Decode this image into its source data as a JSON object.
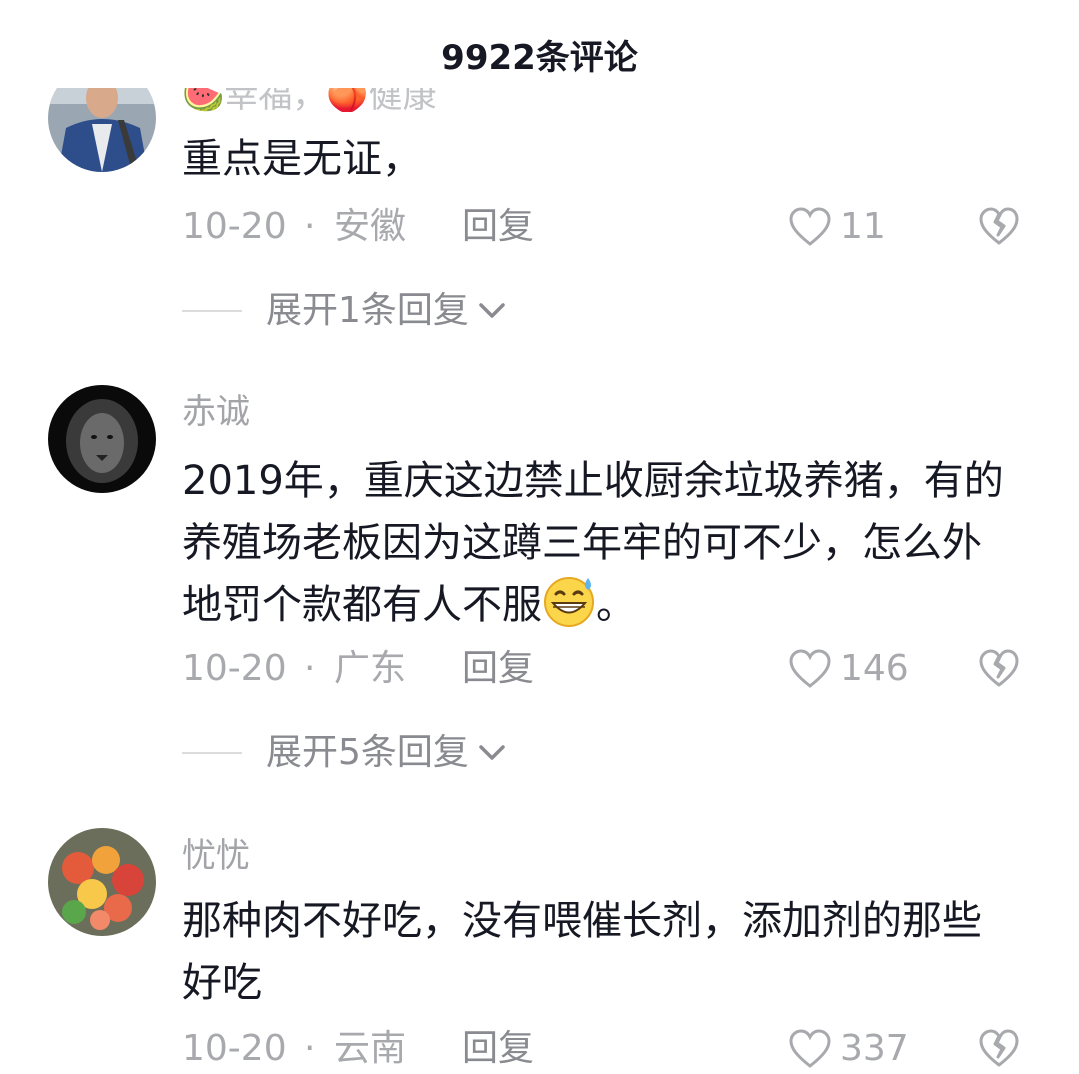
{
  "header": {
    "title": "9922条评论"
  },
  "comments": [
    {
      "partial_top_text": "🍉幸福，🍑健康",
      "text": "重点是无证，",
      "date": "10-20",
      "separator": "·",
      "region": "安徽",
      "reply_label": "回复",
      "likes": "11",
      "expand_label": "展开1条回复"
    },
    {
      "username": "赤诚",
      "text": "2019年，重庆这边禁止收厨余垃圾养猪，有的养殖场老板因为这蹲三年牢的可不少，怎么外地罚个款都有人不服",
      "text_suffix": "。",
      "date": "10-20",
      "separator": "·",
      "region": "广东",
      "reply_label": "回复",
      "likes": "146",
      "expand_label": "展开5条回复"
    },
    {
      "username": "忧忧",
      "text": "那种肉不好吃，没有喂催长剂，添加剂的那些好吃",
      "date": "10-20",
      "separator": "·",
      "region": "云南",
      "reply_label": "回复",
      "likes": "337"
    }
  ],
  "icons": {
    "like": "heart-outline-icon",
    "dislike": "broken-heart-icon",
    "expand": "chevron-down-icon",
    "emoji": "grinning-sweat-emoji"
  }
}
